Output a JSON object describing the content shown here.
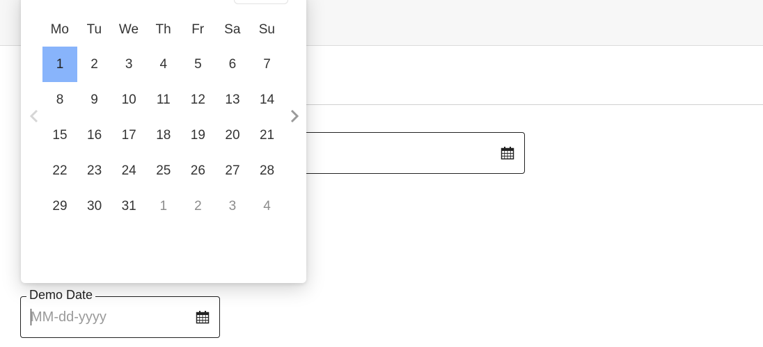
{
  "calendar": {
    "weekdays": [
      "Mo",
      "Tu",
      "We",
      "Th",
      "Fr",
      "Sa",
      "Su"
    ],
    "weeks": [
      [
        {
          "d": "1",
          "o": false,
          "s": true
        },
        {
          "d": "2",
          "o": false
        },
        {
          "d": "3",
          "o": false
        },
        {
          "d": "4",
          "o": false
        },
        {
          "d": "5",
          "o": false
        },
        {
          "d": "6",
          "o": false
        },
        {
          "d": "7",
          "o": false
        }
      ],
      [
        {
          "d": "8",
          "o": false
        },
        {
          "d": "9",
          "o": false
        },
        {
          "d": "10",
          "o": false
        },
        {
          "d": "11",
          "o": false
        },
        {
          "d": "12",
          "o": false
        },
        {
          "d": "13",
          "o": false
        },
        {
          "d": "14",
          "o": false
        }
      ],
      [
        {
          "d": "15",
          "o": false
        },
        {
          "d": "16",
          "o": false
        },
        {
          "d": "17",
          "o": false
        },
        {
          "d": "18",
          "o": false
        },
        {
          "d": "19",
          "o": false
        },
        {
          "d": "20",
          "o": false
        },
        {
          "d": "21",
          "o": false
        }
      ],
      [
        {
          "d": "22",
          "o": false
        },
        {
          "d": "23",
          "o": false
        },
        {
          "d": "24",
          "o": false
        },
        {
          "d": "25",
          "o": false
        },
        {
          "d": "26",
          "o": false
        },
        {
          "d": "27",
          "o": false
        },
        {
          "d": "28",
          "o": false
        }
      ],
      [
        {
          "d": "29",
          "o": false
        },
        {
          "d": "30",
          "o": false
        },
        {
          "d": "31",
          "o": false
        },
        {
          "d": "1",
          "o": true
        },
        {
          "d": "2",
          "o": true
        },
        {
          "d": "3",
          "o": true
        },
        {
          "d": "4",
          "o": true
        }
      ]
    ],
    "prev_icon": "chevron-left-icon",
    "next_icon": "chevron-right-icon",
    "selected_color": "#88b4fb"
  },
  "upper_field": {
    "icon": "calendar-icon"
  },
  "demo_field": {
    "label": "Demo Date",
    "placeholder": "MM-dd-yyyy",
    "value": "",
    "icon": "calendar-icon"
  }
}
